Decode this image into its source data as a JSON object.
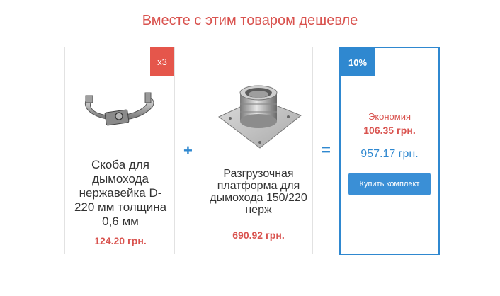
{
  "header": {
    "title": "Вместе с этим товаром дешевле"
  },
  "products": [
    {
      "quantity_badge": "x3",
      "name": "Скоба для дымохода нержавейка D-220 мм толщина 0,6 мм",
      "price": "124.20 грн.",
      "icon": "steel-clamp-image"
    },
    {
      "name": "Разгрузочная платформа для дымохода 150/220 нерж",
      "price": "690.92 грн.",
      "icon": "support-platform-image"
    }
  ],
  "operators": {
    "plus": "+",
    "equals": "="
  },
  "bundle": {
    "discount_badge": "10%",
    "savings_label": "Экономия",
    "savings_amount": "106.35 грн.",
    "total_price": "957.17 грн.",
    "buy_button_label": "Купить комплект"
  },
  "colors": {
    "accent_blue": "#2f88d0",
    "price_red": "#d9534f",
    "badge_red": "#e5564b"
  }
}
